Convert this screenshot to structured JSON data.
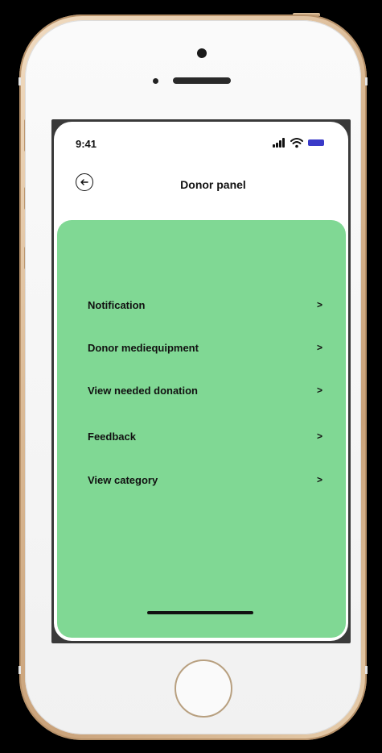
{
  "status_bar": {
    "time": "9:41"
  },
  "header": {
    "title": "Donor panel",
    "back_icon": "arrow-left-circle-icon"
  },
  "menu": {
    "items": [
      {
        "label": "Notification",
        "chevron": ">"
      },
      {
        "label": "Donor mediequipment",
        "chevron": ">"
      },
      {
        "label": "View needed donation",
        "chevron": ">"
      },
      {
        "label": "Feedback",
        "chevron": ">"
      },
      {
        "label": "View category",
        "chevron": ">"
      }
    ]
  },
  "colors": {
    "panel": "#80d894",
    "background": "#000000",
    "screen": "#ffffff",
    "frame": "#d9b893",
    "battery": "#3a3ac8"
  },
  "icons": {
    "signal": "cellular-signal-icon",
    "wifi": "wifi-icon",
    "battery": "battery-icon"
  }
}
